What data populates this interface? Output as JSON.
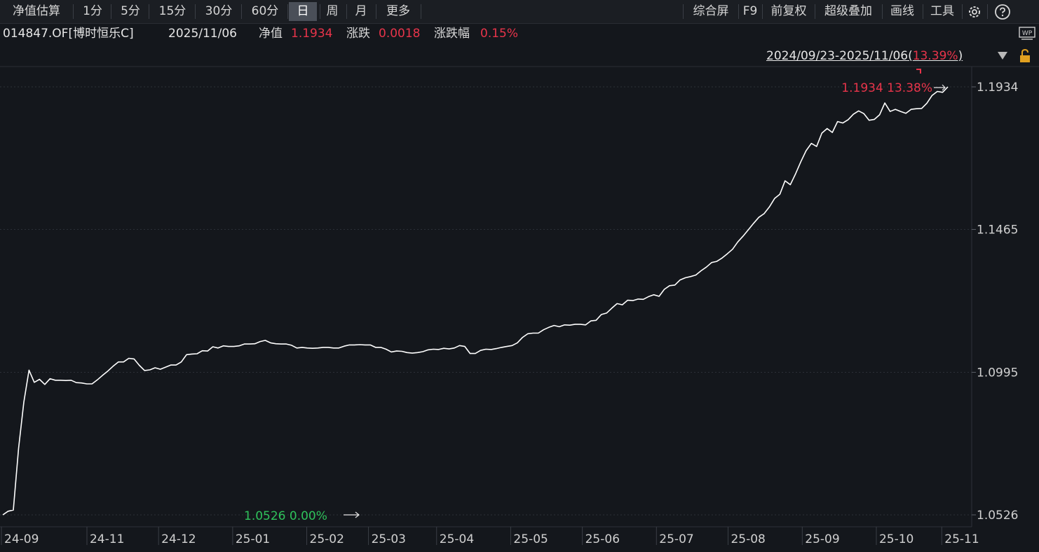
{
  "toolbar": {
    "left": [
      "净值估算",
      "1分",
      "5分",
      "15分",
      "30分",
      "60分",
      "日",
      "周",
      "月",
      "更多"
    ],
    "active": "日",
    "right": [
      "综合屏",
      "F9",
      "前复权",
      "超级叠加",
      "画线",
      "工具"
    ],
    "icons": [
      "gear-icon",
      "help-icon"
    ]
  },
  "info": {
    "code": "014847.OF[博时恒乐C]",
    "date": "2025/11/06",
    "nav_label": "净值",
    "nav_value": "1.1934",
    "change_label": "涨跌",
    "change_value": "0.0018",
    "pct_label": "涨跌幅",
    "pct_value": "0.15%"
  },
  "range": {
    "text": "2024/09/23-2025/11/06(",
    "pct": "13.39%",
    "close": ")"
  },
  "colors": {
    "background": "#14171c",
    "line": "#ffffff",
    "up": "#e8344a",
    "down": "#2fc25b",
    "grid": "#2c3038"
  },
  "chart_data": {
    "type": "line",
    "ylim": [
      1.0526,
      1.1934
    ],
    "y_ticks": [
      "1.1934",
      "1.1465",
      "1.0995",
      "1.0526"
    ],
    "x_ticks": [
      "24-09",
      "24-11",
      "24-12",
      "25-01",
      "25-02",
      "25-03",
      "25-04",
      "25-05",
      "25-06",
      "25-07",
      "25-08",
      "25-09",
      "25-10",
      "25-11"
    ],
    "max_label": "1.1934 13.38%",
    "min_label": "1.0526 0.00%",
    "series": [
      {
        "values": [
          1.0526,
          1.0538,
          1.0542,
          1.0745,
          1.0897,
          1.1002,
          1.0962,
          1.0972,
          1.0955,
          1.0974,
          1.0969,
          1.0969,
          1.0968,
          1.0969,
          1.0961,
          1.096,
          1.0957,
          1.0957,
          1.097,
          1.0985,
          1.0999,
          1.1015,
          1.1029,
          1.1029,
          1.1041,
          1.1039,
          1.1018,
          1.1001,
          1.1003,
          1.101,
          1.1005,
          1.1012,
          1.1019,
          1.1019,
          1.1029,
          1.1053,
          1.1055,
          1.1056,
          1.1066,
          1.1065,
          1.1079,
          1.1075,
          1.1082,
          1.108,
          1.108,
          1.1082,
          1.1088,
          1.1088,
          1.1089,
          1.1096,
          1.11,
          1.1092,
          1.1089,
          1.1088,
          1.1088,
          1.1084,
          1.1075,
          1.1077,
          1.1075,
          1.1074,
          1.1075,
          1.1077,
          1.1077,
          1.1075,
          1.1075,
          1.1081,
          1.1085,
          1.1085,
          1.1086,
          1.1085,
          1.1085,
          1.1077,
          1.1077,
          1.1071,
          1.1062,
          1.1065,
          1.1064,
          1.106,
          1.1058,
          1.106,
          1.1063,
          1.1069,
          1.1071,
          1.107,
          1.1074,
          1.1072,
          1.1075,
          1.1083,
          1.108,
          1.1057,
          1.1057,
          1.1067,
          1.1071,
          1.107,
          1.1073,
          1.1077,
          1.108,
          1.1083,
          1.1092,
          1.111,
          1.1122,
          1.1124,
          1.1124,
          1.1135,
          1.1143,
          1.1149,
          1.1145,
          1.1151,
          1.115,
          1.1153,
          1.1153,
          1.1151,
          1.1164,
          1.1166,
          1.1185,
          1.119,
          1.1206,
          1.1221,
          1.1217,
          1.1232,
          1.1231,
          1.1236,
          1.1235,
          1.1244,
          1.125,
          1.1245,
          1.1268,
          1.128,
          1.1282,
          1.1299,
          1.1306,
          1.131,
          1.1315,
          1.1329,
          1.1341,
          1.1356,
          1.136,
          1.1371,
          1.1385,
          1.14,
          1.1424,
          1.1443,
          1.1464,
          1.1485,
          1.1505,
          1.1517,
          1.1539,
          1.1567,
          1.1581,
          1.1625,
          1.1612,
          1.1648,
          1.1688,
          1.1724,
          1.1748,
          1.1738,
          1.1782,
          1.1797,
          1.1784,
          1.182,
          1.1815,
          1.1826,
          1.1844,
          1.1855,
          1.1846,
          1.1824,
          1.1827,
          1.1842,
          1.1881,
          1.1853,
          1.186,
          1.1853,
          1.1847,
          1.186,
          1.1862,
          1.1863,
          1.188,
          1.1906,
          1.1919,
          1.1916,
          1.1934
        ]
      }
    ]
  }
}
